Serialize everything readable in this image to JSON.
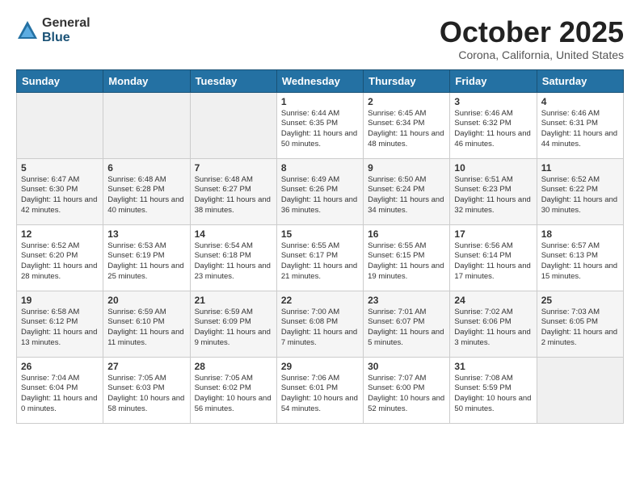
{
  "logo": {
    "general": "General",
    "blue": "Blue"
  },
  "title": "October 2025",
  "location": "Corona, California, United States",
  "days": [
    "Sunday",
    "Monday",
    "Tuesday",
    "Wednesday",
    "Thursday",
    "Friday",
    "Saturday"
  ],
  "weeks": [
    [
      {
        "num": "",
        "text": ""
      },
      {
        "num": "",
        "text": ""
      },
      {
        "num": "",
        "text": ""
      },
      {
        "num": "1",
        "text": "Sunrise: 6:44 AM\nSunset: 6:35 PM\nDaylight: 11 hours\nand 50 minutes."
      },
      {
        "num": "2",
        "text": "Sunrise: 6:45 AM\nSunset: 6:34 PM\nDaylight: 11 hours\nand 48 minutes."
      },
      {
        "num": "3",
        "text": "Sunrise: 6:46 AM\nSunset: 6:32 PM\nDaylight: 11 hours\nand 46 minutes."
      },
      {
        "num": "4",
        "text": "Sunrise: 6:46 AM\nSunset: 6:31 PM\nDaylight: 11 hours\nand 44 minutes."
      }
    ],
    [
      {
        "num": "5",
        "text": "Sunrise: 6:47 AM\nSunset: 6:30 PM\nDaylight: 11 hours\nand 42 minutes."
      },
      {
        "num": "6",
        "text": "Sunrise: 6:48 AM\nSunset: 6:28 PM\nDaylight: 11 hours\nand 40 minutes."
      },
      {
        "num": "7",
        "text": "Sunrise: 6:48 AM\nSunset: 6:27 PM\nDaylight: 11 hours\nand 38 minutes."
      },
      {
        "num": "8",
        "text": "Sunrise: 6:49 AM\nSunset: 6:26 PM\nDaylight: 11 hours\nand 36 minutes."
      },
      {
        "num": "9",
        "text": "Sunrise: 6:50 AM\nSunset: 6:24 PM\nDaylight: 11 hours\nand 34 minutes."
      },
      {
        "num": "10",
        "text": "Sunrise: 6:51 AM\nSunset: 6:23 PM\nDaylight: 11 hours\nand 32 minutes."
      },
      {
        "num": "11",
        "text": "Sunrise: 6:52 AM\nSunset: 6:22 PM\nDaylight: 11 hours\nand 30 minutes."
      }
    ],
    [
      {
        "num": "12",
        "text": "Sunrise: 6:52 AM\nSunset: 6:20 PM\nDaylight: 11 hours\nand 28 minutes."
      },
      {
        "num": "13",
        "text": "Sunrise: 6:53 AM\nSunset: 6:19 PM\nDaylight: 11 hours\nand 25 minutes."
      },
      {
        "num": "14",
        "text": "Sunrise: 6:54 AM\nSunset: 6:18 PM\nDaylight: 11 hours\nand 23 minutes."
      },
      {
        "num": "15",
        "text": "Sunrise: 6:55 AM\nSunset: 6:17 PM\nDaylight: 11 hours\nand 21 minutes."
      },
      {
        "num": "16",
        "text": "Sunrise: 6:55 AM\nSunset: 6:15 PM\nDaylight: 11 hours\nand 19 minutes."
      },
      {
        "num": "17",
        "text": "Sunrise: 6:56 AM\nSunset: 6:14 PM\nDaylight: 11 hours\nand 17 minutes."
      },
      {
        "num": "18",
        "text": "Sunrise: 6:57 AM\nSunset: 6:13 PM\nDaylight: 11 hours\nand 15 minutes."
      }
    ],
    [
      {
        "num": "19",
        "text": "Sunrise: 6:58 AM\nSunset: 6:12 PM\nDaylight: 11 hours\nand 13 minutes."
      },
      {
        "num": "20",
        "text": "Sunrise: 6:59 AM\nSunset: 6:10 PM\nDaylight: 11 hours\nand 11 minutes."
      },
      {
        "num": "21",
        "text": "Sunrise: 6:59 AM\nSunset: 6:09 PM\nDaylight: 11 hours\nand 9 minutes."
      },
      {
        "num": "22",
        "text": "Sunrise: 7:00 AM\nSunset: 6:08 PM\nDaylight: 11 hours\nand 7 minutes."
      },
      {
        "num": "23",
        "text": "Sunrise: 7:01 AM\nSunset: 6:07 PM\nDaylight: 11 hours\nand 5 minutes."
      },
      {
        "num": "24",
        "text": "Sunrise: 7:02 AM\nSunset: 6:06 PM\nDaylight: 11 hours\nand 3 minutes."
      },
      {
        "num": "25",
        "text": "Sunrise: 7:03 AM\nSunset: 6:05 PM\nDaylight: 11 hours\nand 2 minutes."
      }
    ],
    [
      {
        "num": "26",
        "text": "Sunrise: 7:04 AM\nSunset: 6:04 PM\nDaylight: 11 hours\nand 0 minutes."
      },
      {
        "num": "27",
        "text": "Sunrise: 7:05 AM\nSunset: 6:03 PM\nDaylight: 10 hours\nand 58 minutes."
      },
      {
        "num": "28",
        "text": "Sunrise: 7:05 AM\nSunset: 6:02 PM\nDaylight: 10 hours\nand 56 minutes."
      },
      {
        "num": "29",
        "text": "Sunrise: 7:06 AM\nSunset: 6:01 PM\nDaylight: 10 hours\nand 54 minutes."
      },
      {
        "num": "30",
        "text": "Sunrise: 7:07 AM\nSunset: 6:00 PM\nDaylight: 10 hours\nand 52 minutes."
      },
      {
        "num": "31",
        "text": "Sunrise: 7:08 AM\nSunset: 5:59 PM\nDaylight: 10 hours\nand 50 minutes."
      },
      {
        "num": "",
        "text": ""
      }
    ]
  ]
}
